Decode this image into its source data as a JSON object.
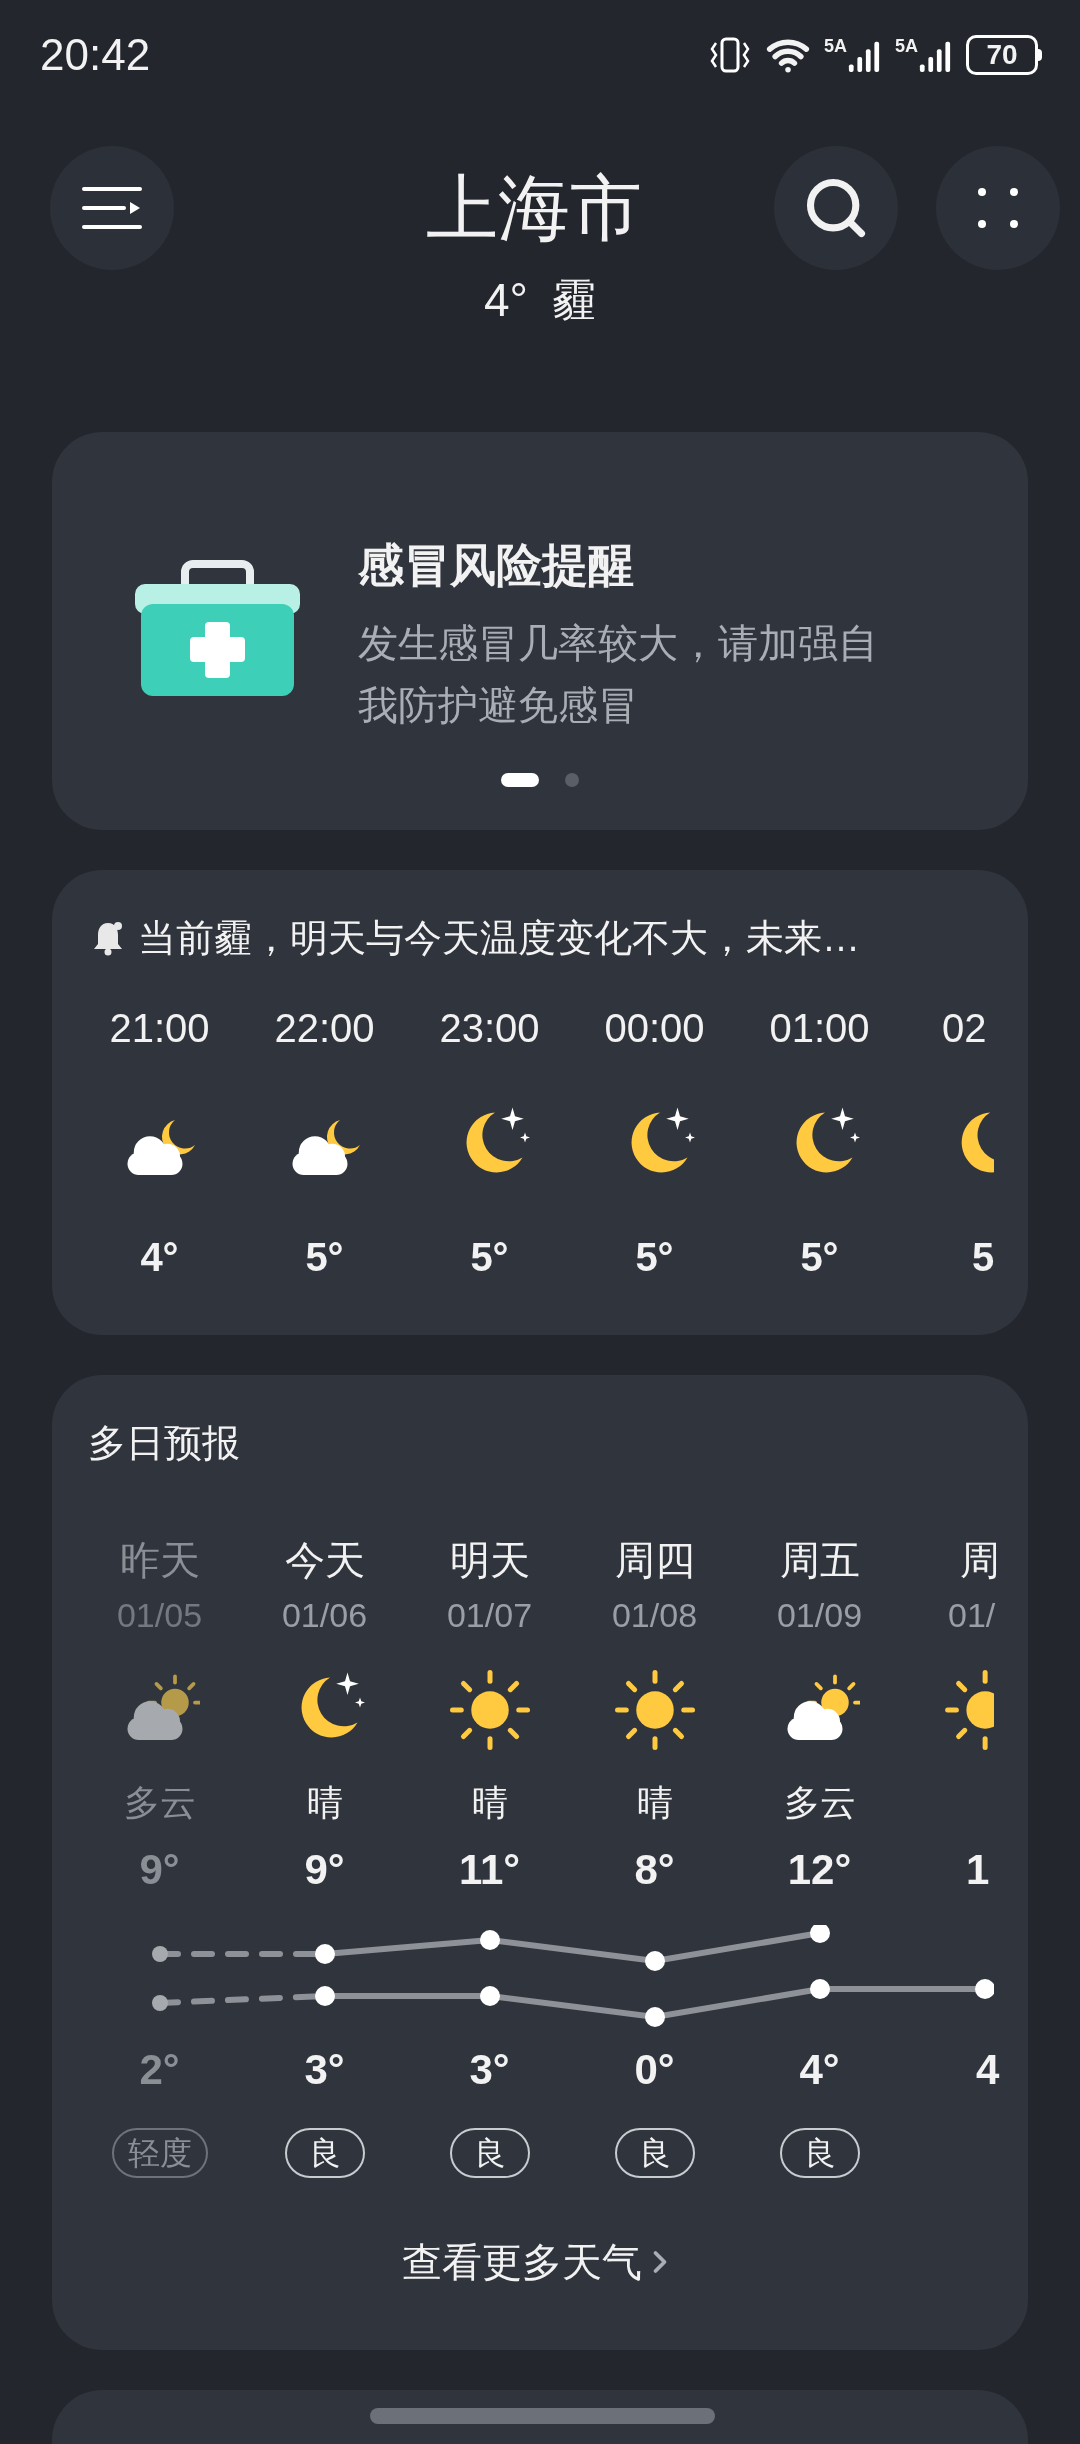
{
  "status_bar": {
    "time": "20:42",
    "signal_labels": [
      "5A",
      "5A"
    ],
    "battery": "70"
  },
  "header": {
    "city": "上海市",
    "temp": "4°",
    "condition": "霾"
  },
  "alert_card": {
    "title": "感冒风险提醒",
    "text": "发生感冒几率较大，请加强自我防护避免感冒",
    "pages": [
      {
        "selected": true
      },
      {
        "selected": false
      }
    ]
  },
  "hourly": {
    "summary": "当前霾，明天与今天温度变化不大，未来…",
    "hours": [
      {
        "time": "21:00",
        "kind": "cloudy_night",
        "temp": "4°"
      },
      {
        "time": "22:00",
        "kind": "cloudy_night",
        "temp": "5°"
      },
      {
        "time": "23:00",
        "kind": "clear_night",
        "temp": "5°"
      },
      {
        "time": "00:00",
        "kind": "clear_night",
        "temp": "5°"
      },
      {
        "time": "01:00",
        "kind": "clear_night",
        "temp": "5°"
      },
      {
        "time": "02",
        "kind": "clear_night",
        "temp": "5"
      }
    ]
  },
  "daily": {
    "title": "多日预报",
    "days": [
      {
        "day": "昨天",
        "date": "01/05",
        "kind": "partly_cloudy",
        "condition": "多云",
        "aqi": "轻度",
        "past": true
      },
      {
        "day": "今天",
        "date": "01/06",
        "kind": "clear_night",
        "condition": "晴",
        "aqi": "良",
        "past": false
      },
      {
        "day": "明天",
        "date": "01/07",
        "kind": "sunny",
        "condition": "晴",
        "aqi": "良",
        "past": false
      },
      {
        "day": "周四",
        "date": "01/08",
        "kind": "sunny",
        "condition": "晴",
        "aqi": "良",
        "past": false
      },
      {
        "day": "周五",
        "date": "01/09",
        "kind": "partly_cloudy",
        "condition": "多云",
        "aqi": "良",
        "past": false
      },
      {
        "day": "周",
        "date": "01/",
        "kind": "sunny",
        "past": false
      }
    ],
    "chart_data": {
      "type": "line",
      "categories": [
        null,
        null,
        null,
        null,
        null,
        null
      ],
      "series": [
        {
          "color": "#8e9197",
          "line_style": "dashed_start",
          "marker": "circle",
          "values": [
            9,
            9,
            11,
            8,
            12,
            null
          ],
          "value_labels": [
            "9°",
            "9°",
            "11°",
            "8°",
            "12°",
            "1"
          ]
        },
        {
          "color": "#8e9197",
          "line_style": "dashed_start",
          "marker": "circle",
          "values": [
            2,
            3,
            3,
            0,
            4,
            4
          ],
          "value_labels": [
            "2°",
            "3°",
            "3°",
            "0°",
            "4°",
            "4"
          ]
        }
      ]
    },
    "more": "查看更多天气"
  }
}
